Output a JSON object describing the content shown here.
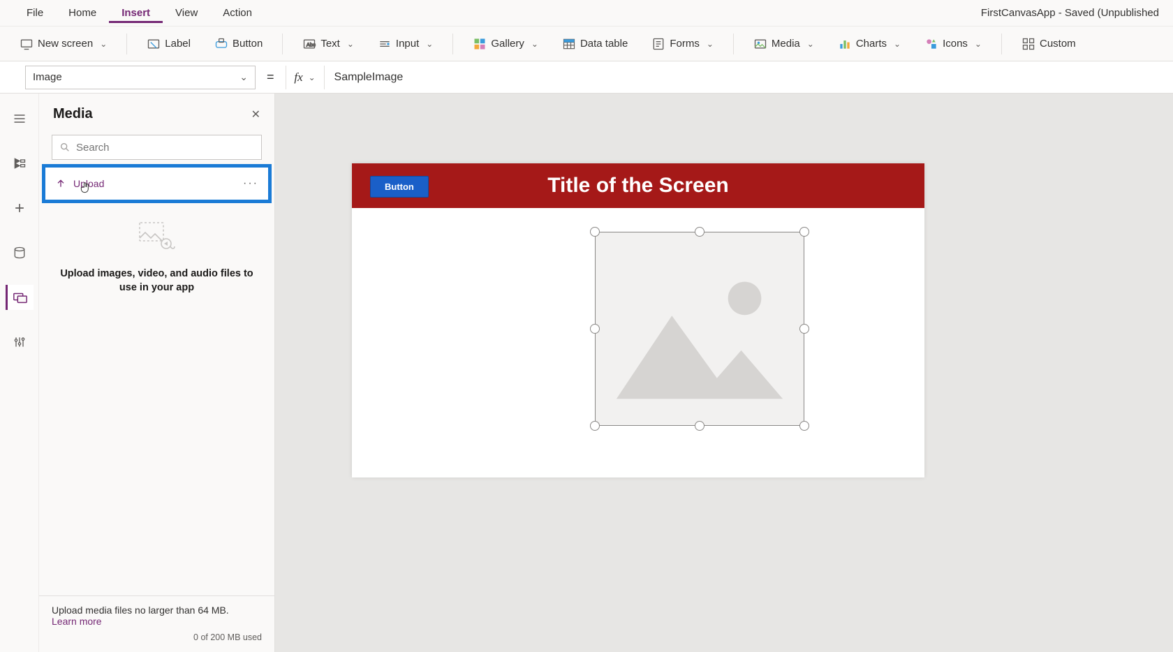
{
  "menu": {
    "items": [
      "File",
      "Home",
      "Insert",
      "View",
      "Action"
    ],
    "active_index": 2,
    "app_title": "FirstCanvasApp - Saved (Unpublished"
  },
  "ribbon": {
    "new_screen": "New screen",
    "label": "Label",
    "button": "Button",
    "text": "Text",
    "input": "Input",
    "gallery": "Gallery",
    "data_table": "Data table",
    "forms": "Forms",
    "media": "Media",
    "charts": "Charts",
    "icons": "Icons",
    "custom": "Custom"
  },
  "formula": {
    "property": "Image",
    "equals": "=",
    "fx": "fx",
    "value": "SampleImage"
  },
  "panel": {
    "title": "Media",
    "search_placeholder": "Search",
    "upload_label": "Upload",
    "empty_text": "Upload images, video, and audio files to use in your app",
    "footer_text": "Upload media files no larger than 64 MB.",
    "learn_more": "Learn more",
    "usage": "0 of 200 MB used"
  },
  "canvas": {
    "header_button": "Button",
    "header_title": "Title of the Screen"
  }
}
